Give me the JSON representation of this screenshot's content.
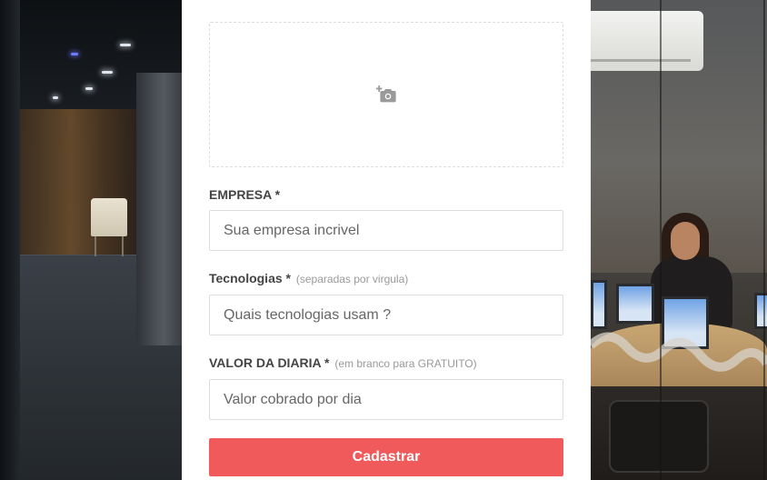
{
  "upload": {
    "icon": "add-photo-icon"
  },
  "form": {
    "company": {
      "label": "EMPRESA *",
      "hint": "",
      "placeholder": "Sua empresa incrivel"
    },
    "techs": {
      "label": "Tecnologias *",
      "hint": "(separadas por virgula)",
      "placeholder": "Quais tecnologias usam ?"
    },
    "price": {
      "label": "VALOR DA DIARIA *",
      "hint": "(em branco para GRATUITO)",
      "placeholder": "Valor cobrado por dia"
    },
    "submit_label": "Cadastrar"
  },
  "colors": {
    "accent": "#f05a5b",
    "label": "#444444",
    "hint": "#999999",
    "border": "#dddddd"
  }
}
